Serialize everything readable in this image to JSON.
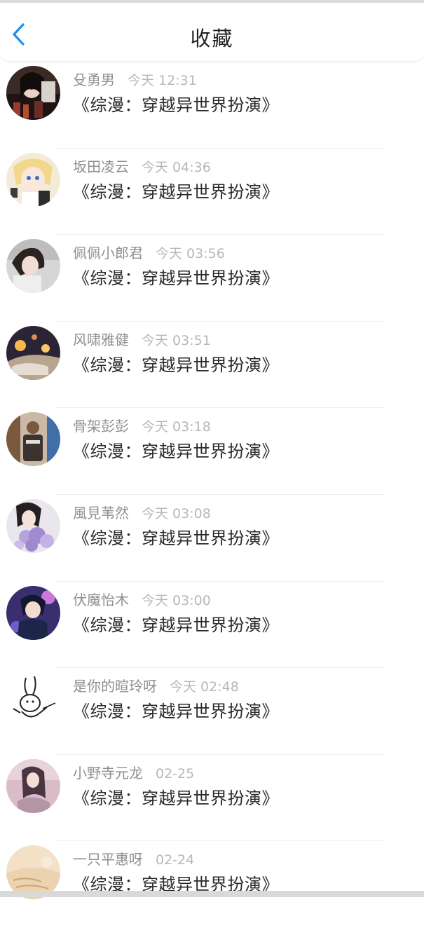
{
  "header": {
    "title": "收藏",
    "back_icon": "chevron-left-icon",
    "accent": "#1a8ef1"
  },
  "favorites": [
    {
      "user": "殳勇男",
      "time": "今天 12:31",
      "book": "《综漫：穿越异世界扮演》"
    },
    {
      "user": "坂田凌云",
      "time": "今天 04:36",
      "book": "《综漫：穿越异世界扮演》"
    },
    {
      "user": "佩佩小郎君",
      "time": "今天 03:56",
      "book": "《综漫：穿越异世界扮演》"
    },
    {
      "user": "风啸雅健",
      "time": "今天 03:51",
      "book": "《综漫：穿越异世界扮演》"
    },
    {
      "user": "骨架彭彭",
      "time": "今天 03:18",
      "book": "《综漫：穿越异世界扮演》"
    },
    {
      "user": "風見苇然",
      "time": "今天 03:08",
      "book": "《综漫：穿越异世界扮演》"
    },
    {
      "user": "伏魔怡木",
      "time": "今天 03:00",
      "book": "《综漫：穿越异世界扮演》"
    },
    {
      "user": "是你的暄玲呀",
      "time": "今天 02:48",
      "book": "《综漫：穿越异世界扮演》"
    },
    {
      "user": "小野寺元龙",
      "time": "02-25",
      "book": "《综漫：穿越异世界扮演》"
    },
    {
      "user": "一只平惠呀",
      "time": "02-24",
      "book": "《综漫：穿越异世界扮演》"
    }
  ]
}
